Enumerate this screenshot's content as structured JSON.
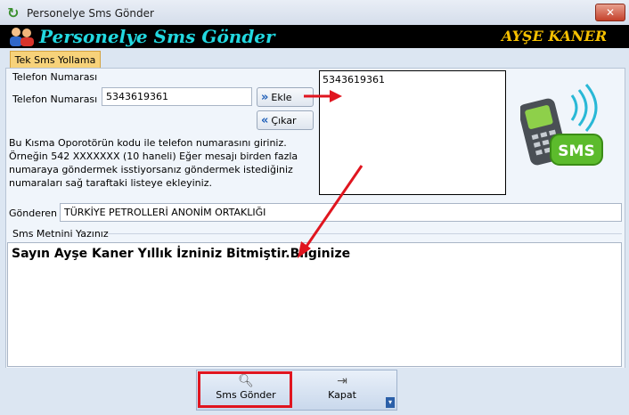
{
  "window": {
    "title": "Personelye Sms Gönder",
    "close_glyph": "✕"
  },
  "banner": {
    "title": "Personelye Sms Gönder",
    "user": "AYŞE KANER"
  },
  "tab": {
    "label": "Tek Sms Yollama"
  },
  "phone_group": {
    "header": "Telefon Numarası",
    "label": "Telefon Numarası",
    "value": "5343619361",
    "add_label": "Ekle",
    "remove_label": "Çıkar",
    "info_text": "Bu Kısma Oporotörün kodu ile telefon numarasını giriniz. Örneğin 542 XXXXXXX  (10 haneli)  Eğer mesajı birden fazla numaraya göndermek isstiyorsanız göndermek istediğiniz numaraları sağ taraftaki listeye ekleyiniz."
  },
  "recipient_list": {
    "items": [
      "5343619361"
    ]
  },
  "sms_badge": {
    "text": "SMS"
  },
  "sender": {
    "label": "Gönderen",
    "value": "TÜRKİYE PETROLLERİ ANONİM ORTAKLIĞI"
  },
  "message": {
    "header": "Sms Metnini Yazınız",
    "text": "Sayın Ayşe Kaner Yıllık İzniniz Bitmiştir.Bilginize"
  },
  "actions": {
    "send_label": "Sms Gönder",
    "close_label": "Kapat"
  },
  "colors": {
    "banner_title": "#22d8e0",
    "banner_user": "#f5c000",
    "highlight": "#e0151f",
    "tab": "#f7d27a"
  }
}
